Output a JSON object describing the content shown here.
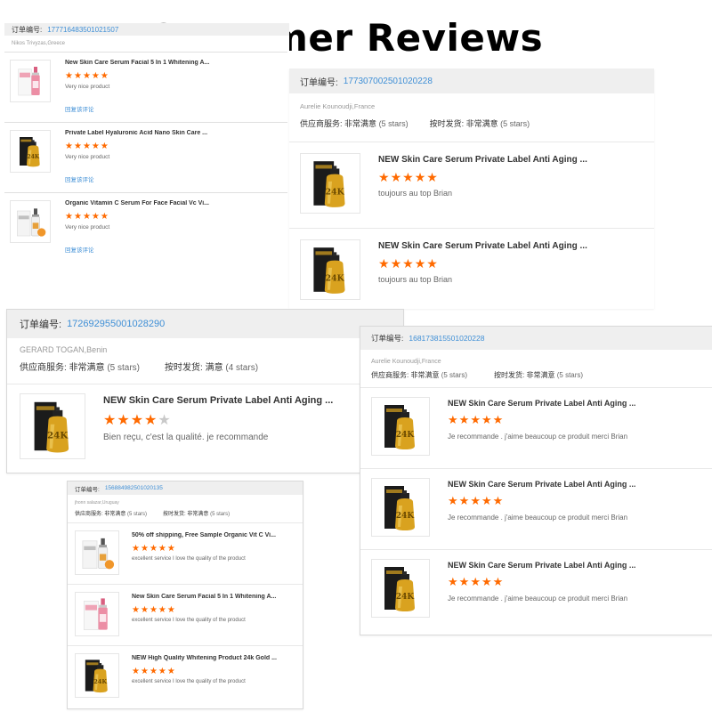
{
  "title": "Customer Reviews",
  "labels": {
    "order_prefix": "订单编号:",
    "supplier_service": "供应商服务:",
    "on_time_shipping": "按时发货:"
  },
  "colors": {
    "star": "#ff6a00",
    "link": "#3f8fd6",
    "header_bg": "#efefef",
    "gold": "#d9a21f",
    "pink": "#ec8ea5"
  },
  "cards": {
    "a": {
      "order_no": "177716483501021507",
      "reviewer": "Nikos Trivyzas,Greece",
      "items": [
        {
          "product": "New Skin Care Serum Facial 5 In 1 Whitening A...",
          "stars": 5,
          "comment": "Very nice product",
          "reply": "回复该评论",
          "icon": "pink-serum-bottle-icon"
        },
        {
          "product": "Private Label Hyaluronic Acid Nano Skin Care ...",
          "stars": 5,
          "comment": "Very nice product",
          "reply": "回复该评论",
          "icon": "gold-24k-serum-icon"
        },
        {
          "product": "Organic Vitamin C Serum For Face Facial Vc Vi...",
          "stars": 5,
          "comment": "Very nice product",
          "reply": "回复该评论",
          "icon": "vitamin-c-serum-icon"
        }
      ]
    },
    "b": {
      "order_no": "177307002501020228",
      "reviewer": "Aurelie Kounoudji,France",
      "service_value": "非常满意",
      "service_count": "(5 stars)",
      "shipping_value": "非常满意",
      "shipping_count": "(5 stars)",
      "items": [
        {
          "product": "NEW Skin Care Serum Private Label Anti Aging ...",
          "stars": 5,
          "comment": "toujours au top Brian",
          "icon": "gold-24k-serum-icon"
        },
        {
          "product": "NEW Skin Care Serum Private Label Anti Aging ...",
          "stars": 5,
          "comment": "toujours au top Brian",
          "icon": "gold-24k-serum-icon"
        }
      ]
    },
    "c": {
      "order_no": "172692955001028290",
      "reviewer": "GERARD TOGAN,Benin",
      "service_value": "非常满意",
      "service_count": "(5 stars)",
      "shipping_value": "满意",
      "shipping_count": "(4 stars)",
      "items": [
        {
          "product": "NEW Skin Care Serum Private Label Anti Aging ...",
          "stars": 4,
          "comment": "Bien reçu, c'est la qualité. je recommande",
          "icon": "gold-24k-serum-icon"
        }
      ]
    },
    "d": {
      "order_no": "168173815501020228",
      "reviewer": "Aurelie Kounoudji,France",
      "service_value": "非常满意",
      "service_count": "(5 stars)",
      "shipping_value": "非常满意",
      "shipping_count": "(5 stars)",
      "items": [
        {
          "product": "NEW Skin Care Serum Private Label Anti Aging ...",
          "stars": 5,
          "comment": "Je recommande . j'aime beaucoup ce produit merci Brian",
          "icon": "gold-24k-serum-icon"
        },
        {
          "product": "NEW Skin Care Serum Private Label Anti Aging ...",
          "stars": 5,
          "comment": "Je recommande . j'aime beaucoup ce produit merci Brian",
          "icon": "gold-24k-serum-icon"
        },
        {
          "product": "NEW Skin Care Serum Private Label Anti Aging ...",
          "stars": 5,
          "comment": "Je recommande . j'aime beaucoup ce produit merci Brian",
          "icon": "gold-24k-serum-icon"
        }
      ]
    },
    "e": {
      "order_no": "156884982501020135",
      "reviewer": "jhonn salazar,Uruguay",
      "service_value": "非常满意",
      "service_count": "(5 stars)",
      "shipping_value": "非常满意",
      "shipping_count": "(5 stars)",
      "items": [
        {
          "product": "50% off shipping, Free Sample Organic Vit C Vi...",
          "stars": 5,
          "comment": "excellent service I love the quality of the product",
          "icon": "vitamin-c-serum-icon"
        },
        {
          "product": "New Skin Care Serum Facial 5 In 1 Whitening A...",
          "stars": 5,
          "comment": "excellent service I love the quality of the product",
          "icon": "pink-serum-bottle-icon"
        },
        {
          "product": "NEW High Quality Whitening Product 24k Gold ...",
          "stars": 5,
          "comment": "excellent service I love the quality of the product",
          "icon": "gold-24k-serum-icon"
        }
      ]
    }
  }
}
